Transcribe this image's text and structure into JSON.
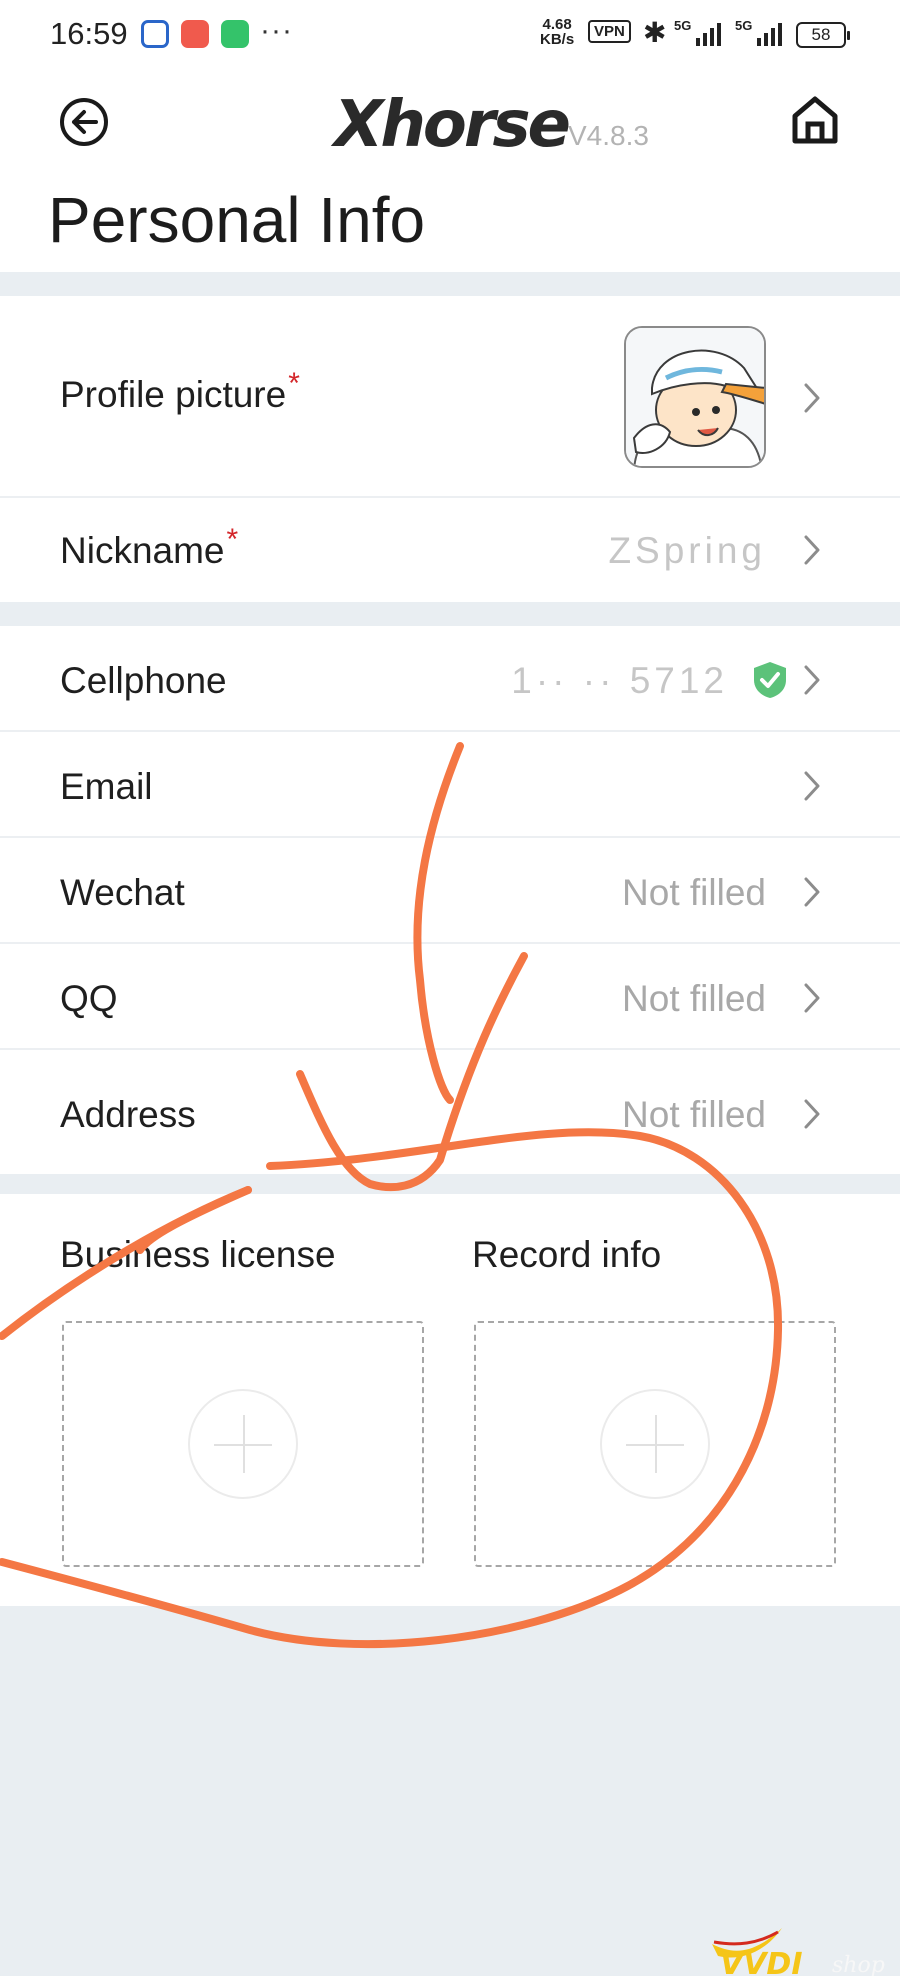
{
  "status_bar": {
    "time": "16:59",
    "dots": "···",
    "net_speed_value": "4.68",
    "net_speed_unit": "KB/s",
    "vpn": "VPN",
    "signal1": "5G",
    "signal2": "5G",
    "battery": "58"
  },
  "header": {
    "logo": "Xhorse",
    "version": "V4.8.3",
    "title": "Personal Info"
  },
  "rows": {
    "profile_picture": {
      "label": "Profile picture",
      "required": "*"
    },
    "nickname": {
      "label": "Nickname",
      "required": "*",
      "value": "ZSpring"
    },
    "cellphone": {
      "label": "Cellphone",
      "value": "1·· ·· 5712"
    },
    "email": {
      "label": "Email",
      "value": ""
    },
    "wechat": {
      "label": "Wechat",
      "value": "Not filled"
    },
    "qq": {
      "label": "QQ",
      "value": "Not filled"
    },
    "address": {
      "label": "Address",
      "value": "Not filled"
    }
  },
  "uploads": {
    "business_license": "Business license",
    "record_info": "Record info"
  },
  "watermark": "VVDI shop",
  "colors": {
    "annotation": "#f47744",
    "required": "#d3262a",
    "verified": "#5cc27a",
    "placeholder": "#a8a8a8",
    "divider_bg": "#e9eef2"
  },
  "icons": [
    "back-icon",
    "home-icon",
    "chevron-right-icon",
    "verified-shield-icon",
    "plus-icon"
  ]
}
